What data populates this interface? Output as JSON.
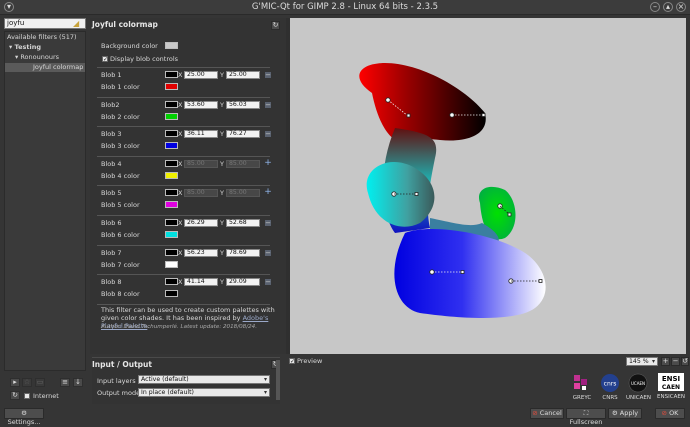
{
  "window": {
    "title": "G'MIC-Qt for GIMP 2.8 - Linux 64 bits - 2.3.5"
  },
  "filters": {
    "search_value": "joyfu",
    "available_label": "Available filters (517)",
    "tree": [
      {
        "label": "▾  Testing"
      },
      {
        "label": "▾  Ronounours"
      },
      {
        "label": "Joyful colormap"
      }
    ],
    "internet_label": "Internet",
    "settings_label": "Settings..."
  },
  "filter_panel": {
    "title": "Joyful colormap",
    "background_color_label": "Background color",
    "display_blob_controls_label": "Display blob controls",
    "blobs": [
      {
        "label": "Blob 1",
        "color_label": "Blob 1 color",
        "x": "25.00",
        "y": "25.00",
        "color": "#e00000",
        "enabled": true
      },
      {
        "label": "Blob2",
        "color_label": "Blob 2 color",
        "x": "53.60",
        "y": "56.03",
        "color": "#00d000",
        "enabled": true
      },
      {
        "label": "Blob 3",
        "color_label": "Blob 3 color",
        "x": "36.11",
        "y": "76.27",
        "color": "#0000e0",
        "enabled": true
      },
      {
        "label": "Blob 4",
        "color_label": "Blob 4 color",
        "x": "85.00",
        "y": "85.00",
        "color": "#f0f000",
        "enabled": false
      },
      {
        "label": "Blob 5",
        "color_label": "Blob 5 color",
        "x": "85.00",
        "y": "85.00",
        "color": "#e000e0",
        "enabled": false
      },
      {
        "label": "Blob 6",
        "color_label": "Blob 6 color",
        "x": "26.29",
        "y": "52.68",
        "color": "#00e0e0",
        "enabled": true
      },
      {
        "label": "Blob 7",
        "color_label": "Blob 7 color",
        "x": "56.23",
        "y": "78.69",
        "color": "#ffffff",
        "enabled": true
      },
      {
        "label": "Blob 8",
        "color_label": "Blob 8 color",
        "x": "41.14",
        "y": "29.09",
        "color": "#000000",
        "enabled": true
      }
    ],
    "description": "This filter can be used to create custom palettes with given color shades. It has been inspired by",
    "link_text": "Adobe's Playful Palette",
    "author": "Author: David Tschumperlé. Latest update: 2018/08/24."
  },
  "io": {
    "title": "Input / Output",
    "input_layers_label": "Input layers",
    "input_layers_value": "Active (default)",
    "output_mode_label": "Output mode",
    "output_mode_value": "In place (default)"
  },
  "preview": {
    "preview_label": "Preview",
    "zoom": "145 %"
  },
  "logos": [
    "GREYC",
    "CNRS",
    "UNICAEN",
    "ENSICAEN"
  ],
  "buttons": {
    "cancel": "Cancel",
    "fullscreen": "Fullscreen",
    "apply": "Apply",
    "ok": "OK"
  },
  "colors": {
    "accent": "#c0392b",
    "link": "#9aa8c8"
  }
}
